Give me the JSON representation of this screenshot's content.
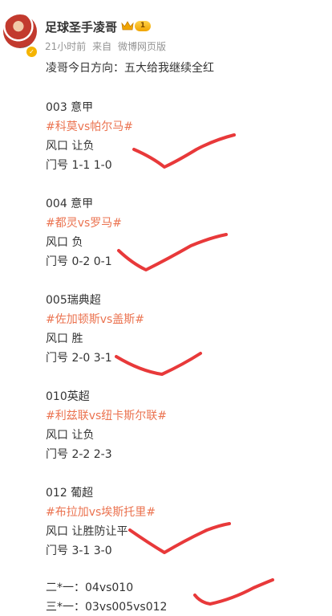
{
  "post": {
    "author": "足球圣手凌哥",
    "level": "1",
    "time": "21小时前",
    "source_prefix": "来自",
    "source": "微博网页版"
  },
  "content": {
    "intro": "凌哥今日方向：五大给我继续全红",
    "matches": [
      {
        "header": "003 意甲",
        "topic": "#科莫vs帕尔马#",
        "tip": "风口 让负",
        "score": "门号  1-1 1-0"
      },
      {
        "header": "004 意甲",
        "topic": "#都灵vs罗马#",
        "tip": "风口 负",
        "score": "门号  0-2 0-1"
      },
      {
        "header": "005瑞典超",
        "topic": "#佐加顿斯vs盖斯#",
        "tip": "风口 胜",
        "score": "门号 2-0 3-1"
      },
      {
        "header": "010英超",
        "topic": "#利兹联vs纽卡斯尔联#",
        "tip": "风口 让负",
        "score": "门号 2-2 2-3"
      },
      {
        "header": "012 葡超",
        "topic": "#布拉加vs埃斯托里#",
        "tip": "风口 让胜防让平",
        "score": "门号 3-1 3-0"
      }
    ],
    "combo1": "二*一：04vs010",
    "combo2": "三*一：03vs005vs012"
  },
  "colors": {
    "topic": "#eb7350",
    "check_mark": "#e8393a",
    "meta": "#939393"
  }
}
